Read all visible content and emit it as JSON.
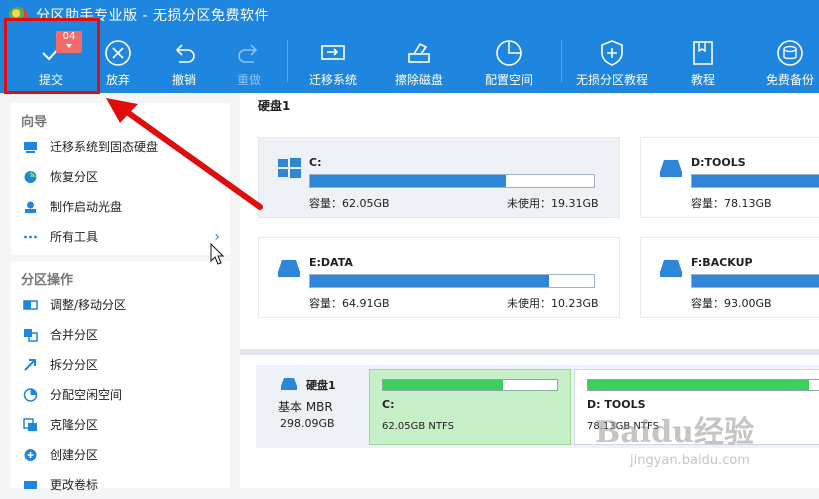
{
  "window": {
    "title": "分区助手专业版 - 无损分区免费软件"
  },
  "toolbar": {
    "items": [
      {
        "label": "提交",
        "icon": "check-icon"
      },
      {
        "label": "放弃",
        "icon": "x-circle-icon"
      },
      {
        "label": "撤销",
        "icon": "undo-icon"
      },
      {
        "label": "重做",
        "icon": "redo-icon"
      },
      {
        "label": "迁移系统",
        "icon": "migrate-icon"
      },
      {
        "label": "擦除磁盘",
        "icon": "eraser-icon"
      },
      {
        "label": "配置空间",
        "icon": "pie-icon"
      },
      {
        "label": "无损分区教程",
        "icon": "shield-icon"
      },
      {
        "label": "教程",
        "icon": "book-icon"
      },
      {
        "label": "免费备份",
        "icon": "backup-icon"
      }
    ],
    "badge": "04"
  },
  "sidebar": {
    "guide": {
      "title": "向导",
      "items": [
        "迁移系统到固态硬盘",
        "恢复分区",
        "制作启动光盘",
        "所有工具"
      ]
    },
    "ops": {
      "title": "分区操作",
      "items": [
        "调整/移动分区",
        "合并分区",
        "拆分分区",
        "分配空闲空间",
        "克隆分区",
        "创建分区",
        "更改卷标"
      ]
    }
  },
  "main": {
    "disk_title": "硬盘1",
    "cards": [
      {
        "name": "C:",
        "capacity": "容量：62.05GB",
        "free": "未使用：19.31GB",
        "used": 0.69
      },
      {
        "name": "D:TOOLS",
        "capacity": "容量：78.13GB",
        "free": "",
        "used": 0.95
      },
      {
        "name": "E:DATA",
        "capacity": "容量：64.91GB",
        "free": "未使用：10.23GB",
        "used": 0.84
      },
      {
        "name": "F:BACKUP",
        "capacity": "容量：93.00GB",
        "free": "",
        "used": 0.95
      }
    ],
    "map": {
      "disk_name": "硬盘1",
      "disk_type": "基本 MBR",
      "disk_size": "298.09GB",
      "partitions": [
        {
          "name": "C:",
          "info": "62.05GB NTFS",
          "used": 0.69
        },
        {
          "name": "D: TOOLS",
          "info": "78.13GB NTFS",
          "used": 0.95
        }
      ]
    }
  },
  "watermark": {
    "brand": "Baidu经验",
    "url": "jingyan.baidu.com"
  },
  "colors": {
    "toolbar": "#1f86df",
    "bar_fill": "#2d86d8",
    "partition_fill": "#3dcf5d",
    "highlight": "#e00d0d"
  }
}
